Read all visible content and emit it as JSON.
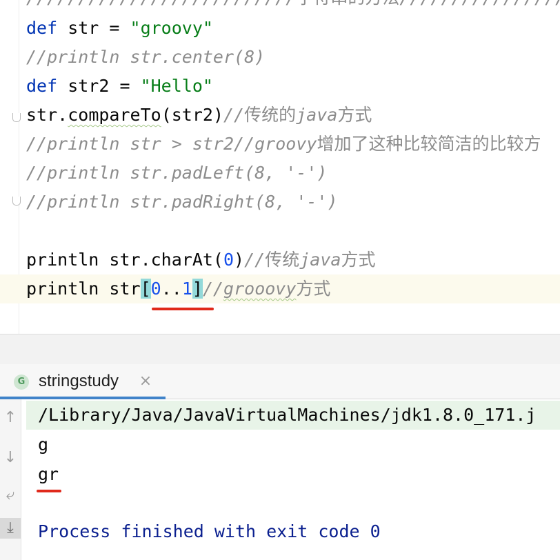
{
  "editor": {
    "top_partial": {
      "slashes_a": "//////////////////////////",
      "cjk": "字符串的方法",
      "slashes_b": "////////////////"
    },
    "line1": {
      "kw": "def",
      "rest": " str = ",
      "str": "\"groovy\""
    },
    "line2": {
      "comment": "//println str.center(8)"
    },
    "line3": {
      "kw": "def",
      "rest": " str2 = ",
      "str": "\"Hello\""
    },
    "line4": {
      "code_a": "str.",
      "method": "compareTo",
      "code_b": "(str2)",
      "comment_a": "//",
      "comment_cjk": "传统的",
      "comment_b": "java",
      "comment_cjk2": "方式"
    },
    "line5": {
      "comment_a": "//println str > str2//groovy",
      "comment_cjk": "增加了这种比较简洁的比较方"
    },
    "line6": {
      "comment": "//println str.padLeft(8, '-')"
    },
    "line7": {
      "comment": "//println str.padRight(8, '-')"
    },
    "line8": {
      "code_a": "println str.charAt(",
      "num": "0",
      "code_b": ")",
      "comment_a": "//",
      "comment_cjk": "传统",
      "comment_b": "java",
      "comment_cjk2": "方式"
    },
    "line9": {
      "code_a": "println str",
      "open": "[",
      "num0": "0",
      "range": "..",
      "num1": "1",
      "close": "]",
      "comment_a": "//",
      "comment_b": "grooovy",
      "comment_cjk": "方式"
    }
  },
  "run_panel": {
    "tab": {
      "icon_letter": "G",
      "label": "stringstudy",
      "close": "×"
    },
    "tools": {
      "up": "↑",
      "down": "↓",
      "wrap": "⤶",
      "scroll_end": "⤓"
    },
    "output": [
      "/Library/Java/JavaVirtualMachines/jdk1.8.0_171.j",
      "g",
      "gr",
      "",
      "Process finished with exit code 0"
    ]
  },
  "colors": {
    "keyword": "#0033b3",
    "string": "#067d17",
    "comment": "#8c8c8c",
    "number": "#1750eb",
    "annotation_red": "#e0291b",
    "tab_accent": "#4083c9"
  }
}
